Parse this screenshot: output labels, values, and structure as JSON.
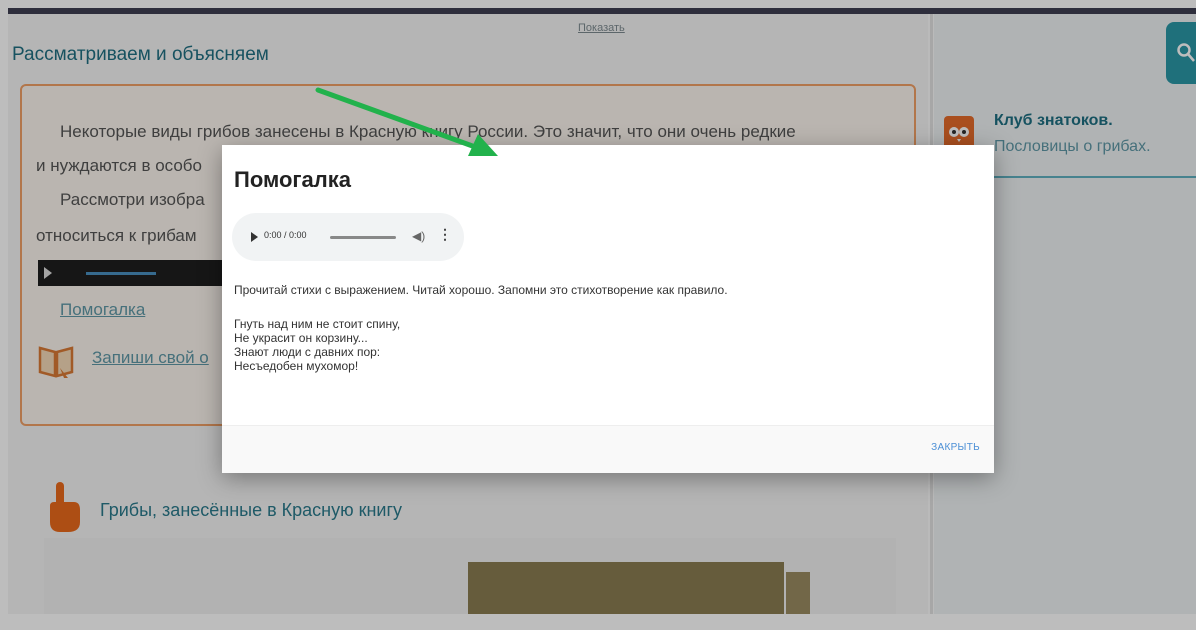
{
  "page": {
    "show_link": "Показать",
    "section_title": "Рассматриваем и объясняем",
    "content": {
      "paragraph1_line1": "Некоторые виды грибов занесены в Красную книгу России. Это значит, что они очень редкие",
      "paragraph1_line2": "и нуждаются в особо",
      "paragraph2_line1": "Рассмотри изобра",
      "paragraph2_line2": "относиться к грибам",
      "link_pomogalka": "Помогалка",
      "link_zapishi": "Запиши свой о"
    },
    "section2_title": "Грибы, занесённые в Красную книгу"
  },
  "sidebar": {
    "club_title": "Клуб знатоков.",
    "club_subtitle": "Пословицы о грибах."
  },
  "modal": {
    "title": "Помогалка",
    "audio_time": "0:00 / 0:00",
    "instruction": "Прочитай стихи с выражением. Читай хорошо. Запомни это стихотворение как правило.",
    "poem": [
      "Гнуть над ним не стоит спину,",
      "Не украсит он корзину...",
      "Знают люди с давних пор:",
      "Несъедобен мухомор!"
    ],
    "close_label": "ЗАКРЫТЬ"
  },
  "icons": {
    "search": "search-icon",
    "club": "owl-icon",
    "book": "book-icon",
    "hand": "pointing-hand-icon",
    "annotation": "green-arrow-icon"
  },
  "colors": {
    "accent_teal": "#2b97a6",
    "orange": "#f0a066",
    "annotation_green": "#22b24c",
    "close_blue": "#4b8fd6"
  }
}
